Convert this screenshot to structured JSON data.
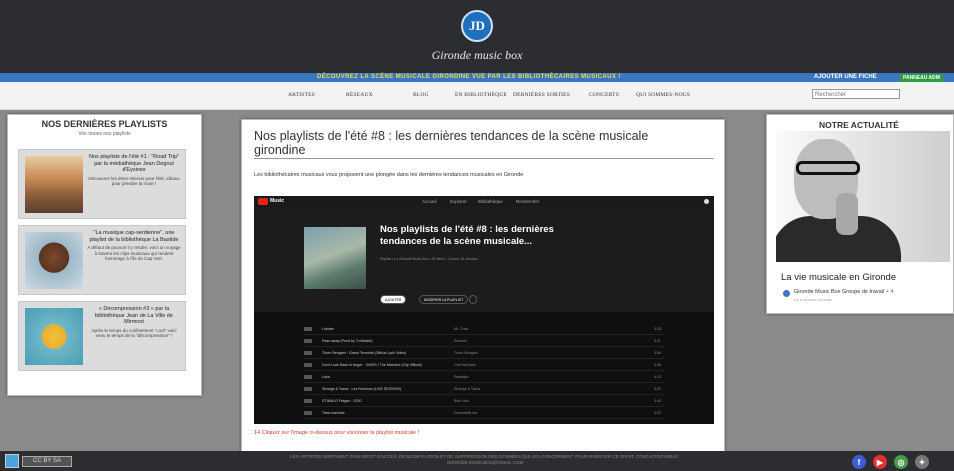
{
  "header": {
    "logo_letters": "JD",
    "logo_text": "Gironde music box",
    "tagline": "DÉCOUVREZ LA SCÈNE MUSICALE GIRONDINE VUE PAR LES BIBLIOTHÉCAIRES MUSICAUX !",
    "add_label": "AJOUTER UNE FICHE",
    "panneau_label": "PANNEAU ADM"
  },
  "nav": {
    "items": [
      "ARTISTES",
      "RÉSEAUX",
      "BLOG",
      "EN BIBLIOTHÈQUE",
      "DERNIÈRES SORTIES",
      "CONCERTS",
      "QUI SOMMES-NOUS"
    ],
    "search_placeholder": "Rechercher"
  },
  "left": {
    "title": "NOS DERNIÈRES PLAYLISTS",
    "see_all": "Voir toutes nos playlists",
    "cards": [
      {
        "title": "Nos playlists de l'été #1 : \"Road Trip\" par la médiathèque Jean Degoul d'Eysines",
        "desc": "Découvrez les titres retenus pour l'été, idéaux pour prendre la route !"
      },
      {
        "title": "\"La musique cap-verdienne\", une playlist de la bibliothèque La Bastide",
        "desc": "A défaut de pouvoir s'y rendre, voici un voyage à travers les clips musicaux qui rendent hommage à l'île du Cap Vert."
      },
      {
        "title": "« Décompression #3 » par la bibliothèque Jean de La Ville de Mirmont",
        "desc": "Après le temps du confinement \"cool\" voici venu le temps de la \"décompression\" !"
      }
    ]
  },
  "article": {
    "title": "Nos playlists de l'été #8 : les dernières tendances de la scène musicale girondine",
    "intro": "Les bibliothécaires musicaux vous proposent une plongée dans les dernières tendances musicales en Gironde",
    "cta": "Cliquez sur l'image ci-dessus pour visionner la playlist musicale !",
    "cta_prefix": "14"
  },
  "embed": {
    "app": "Music",
    "nav": [
      "Accueil",
      "Explorer",
      "Bibliothèque",
      "Rechercher"
    ],
    "playlist_title": "Nos playlists de l'été #8 : les dernières tendances de la scène musicale...",
    "meta": "Playlist • La Gironde Music Box • 30 titres • 1 heure 20 minutes",
    "add_label": "AJOUTER",
    "edit_label": "MODIFIER LA PLAYLIST",
    "tracks": [
      {
        "title": "Lobster",
        "artist": "Mr. Crow",
        "dur": "3:25"
      },
      {
        "title": "Pass away (Proof by Tvnfinisht)",
        "artist": "Scarcell",
        "dur": "3:11"
      },
      {
        "title": "Thorn Benglert · Grand Terminal (Official Lyric Video)",
        "artist": "Thorn Benglert",
        "dur": "3:56"
      },
      {
        "title": "Don't Look Back In Anger · OASIS / The Machine (Clip Officiel)",
        "artist": "Odd McCartin",
        "dur": "4:06"
      },
      {
        "title": "Lava",
        "artist": "Pastaljes",
        "dur": "4:12"
      },
      {
        "title": "Strange & Tacos · Les Rumeurs (LIVE SESSION)",
        "artist": "Strange & Tacos",
        "dur": "3:52"
      },
      {
        "title": "STIMULO Frageu · 2020",
        "artist": "Bleu Noir",
        "dur": "3:40"
      },
      {
        "title": "Tired machine",
        "artist": "Debordelle Ine",
        "dur": "4:02"
      }
    ]
  },
  "right": {
    "title": "NOTRE ACTUALITÉ",
    "news_title": "La vie musicale en Gironde",
    "news_sub": "Gironde Music Box Groupe de travail",
    "news_plus": "+ 4",
    "news_date": "il y a environ un mois"
  },
  "footer": {
    "text": "LES ARTISTES DISPOSENT D'UN DROIT D'ACCÈS, DE MODIFICATION ET DE SUPPRESSION DES DONNÉES QUI LES CONCERNENT. POUR EXERCER CE DROIT, CONTACTEZ-NOUS :",
    "email": "GIRONDE.MUSICBOX@GMAIL.COM",
    "cc_label": "CC BY SA"
  },
  "colors": {
    "accent_blue": "#3a77c0",
    "tagline_yellow": "#f2d94a",
    "cta_red": "#d83a2a"
  }
}
